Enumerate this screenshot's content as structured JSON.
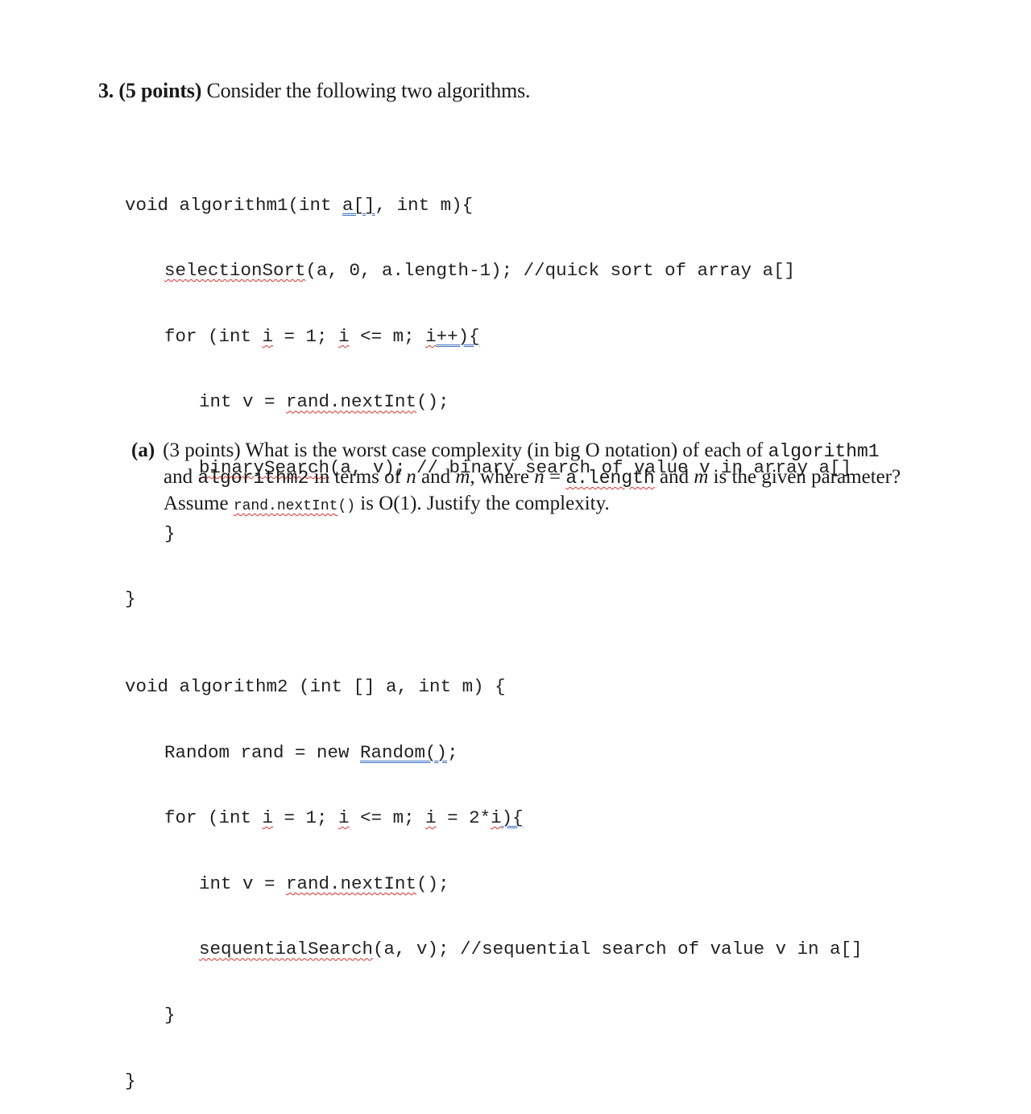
{
  "question": {
    "number": "3.",
    "points": "(5 points)",
    "prompt": " Consider the following two algorithms."
  },
  "code": {
    "algorithm1": {
      "signature_prefix": "void algorithm1(int ",
      "signature_param_a": "a[]",
      "signature_suffix": ", int m){",
      "line2_call": "selectionSort",
      "line2_rest": "(a, 0, a.length-1); //quick sort of array a[]",
      "line3_for_prefix": "for (int ",
      "line3_i1": "i",
      "line3_mid1": " = 1; ",
      "line3_i2": "i",
      "line3_mid2": " <= m; ",
      "line3_i3": "i",
      "line3_incr": "++){",
      "line4_prefix": "int v = ",
      "line4_call": "rand.nextInt",
      "line4_suffix": "();",
      "line5_call": "binarySearch",
      "line5_rest": "(a, v); // binary search of value v in array a[]",
      "close_inner": "}",
      "close_outer": "}"
    },
    "algorithm2": {
      "signature": "void algorithm2 (int [] a, int m) {",
      "line2_prefix": "Random rand = new ",
      "line2_ctor": "Random()",
      "line2_suffix": ";",
      "line3_for_prefix": "for (int ",
      "line3_i1": "i",
      "line3_mid1": " = 1; ",
      "line3_i2": "i",
      "line3_mid2": " <= m; ",
      "line3_i3": "i",
      "line3_mid3": " = 2*",
      "line3_i4": "i",
      "line3_end": "){",
      "line4_prefix": "int v = ",
      "line4_call": "rand.nextInt",
      "line4_suffix": "();",
      "line5_call": "sequentialSearch",
      "line5_rest": "(a, v); //sequential search of value v in a[]",
      "close_inner": "}",
      "close_outer": "}"
    }
  },
  "part_a": {
    "label": "(a)",
    "line1_text": "(3 points) What is the worst case complexity (in big O notation) of each of ",
    "line1_code": "algorithm1",
    "line2_and": "and ",
    "line2_code": "algorithm2",
    "line2_text1": " in terms of ",
    "var_n": "n",
    "line2_text2": " and ",
    "var_m": "m",
    "line2_text3": ", where ",
    "var_n2": "n",
    "line2_eq": " = ",
    "line2_code2": "a.length",
    "line2_text4": " and ",
    "var_m2": "m",
    "line2_text5": " is the given parameter?",
    "line3_text1": "Assume ",
    "line3_code": "rand.nextInt",
    "line3_code_parens": "()",
    "line3_text2": " is O(1). Justify the complexity."
  },
  "colors": {
    "spellcheck_underline": "#d9312b",
    "grammar_underline": "#3d6fc4",
    "text": "#1a1a1a"
  }
}
